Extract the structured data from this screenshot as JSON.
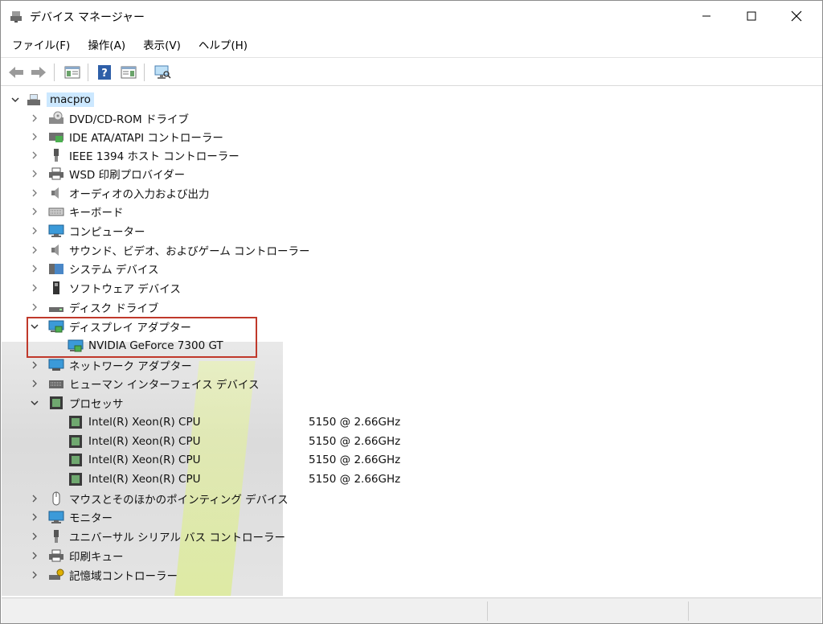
{
  "window": {
    "title": "デバイス マネージャー"
  },
  "menu": [
    "ファイル(F)",
    "操作(A)",
    "表示(V)",
    "ヘルプ(H)"
  ],
  "toolbar": [
    "back-arrow-icon",
    "forward-arrow-icon",
    "properties-icon",
    "help-icon",
    "view-icon",
    "monitor-scan-icon"
  ],
  "tree": {
    "root": "macpro",
    "categories": [
      "DVD/CD-ROM ドライブ",
      "IDE ATA/ATAPI コントローラー",
      "IEEE 1394 ホスト コントローラー",
      "WSD 印刷プロバイダー",
      "オーディオの入力および出力",
      "キーボード",
      "コンピューター",
      "サウンド、ビデオ、およびゲーム コントローラー",
      "システム デバイス",
      "ソフトウェア デバイス",
      "ディスク ドライブ",
      "ディスプレイ アダプター",
      "ネットワーク アダプター",
      "ヒューマン インターフェイス デバイス",
      "プロセッサ",
      "マウスとそのほかのポインティング デバイス",
      "モニター",
      "ユニバーサル シリアル バス コントローラー",
      "印刷キュー",
      "記憶域コントローラー"
    ],
    "display_child": "NVIDIA GeForce 7300 GT",
    "cpu_name": "Intel(R) Xeon(R) CPU",
    "cpu_speed": "5150  @ 2.66GHz"
  },
  "colors": {
    "highlight": "#c0392b",
    "selection": "#cce8ff"
  }
}
